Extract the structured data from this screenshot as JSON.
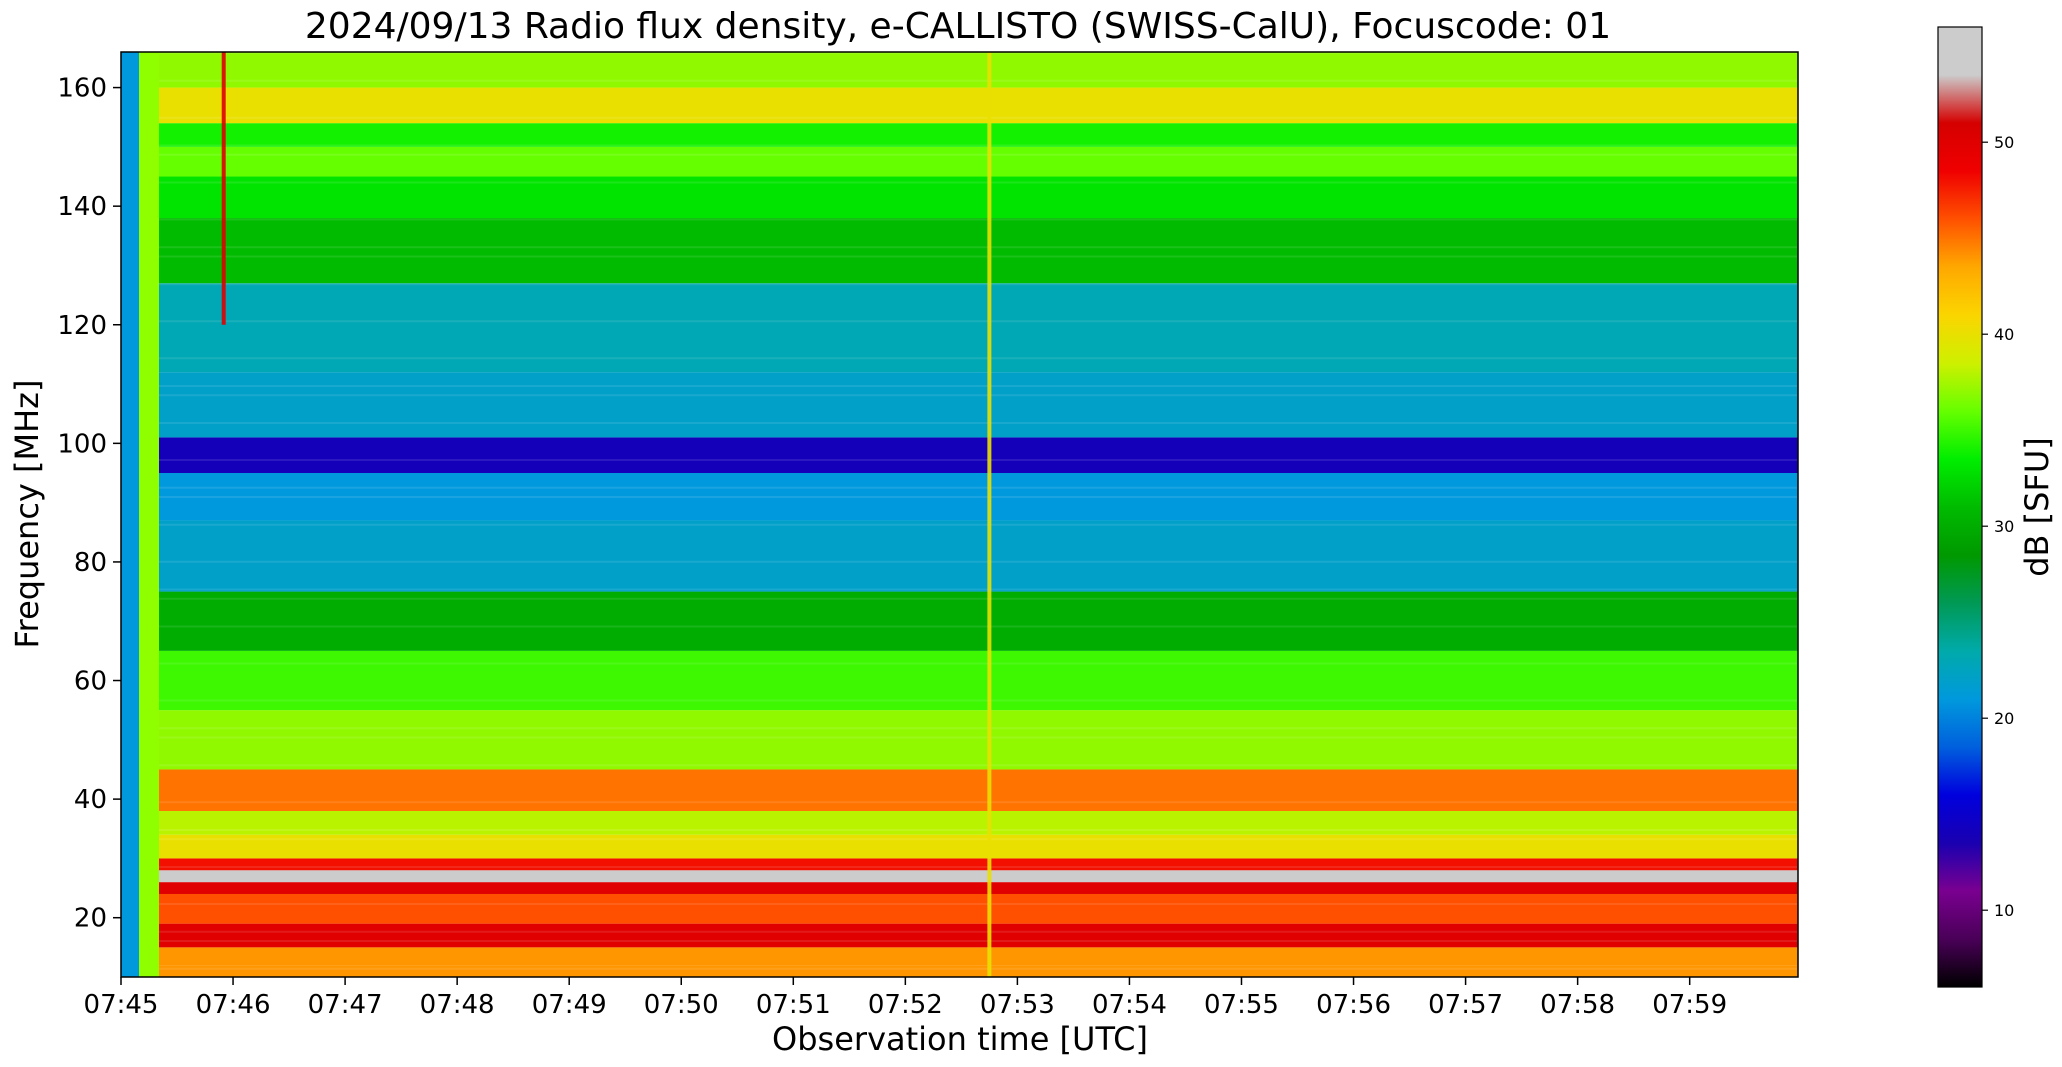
{
  "chart_data": {
    "type": "heatmap",
    "title": "2024/09/13  Radio flux density, e-CALLISTO (SWISS-CalU), Focuscode: 01",
    "xlabel": "Observation time [UTC]",
    "ylabel": "Frequency [MHz]",
    "x_range": [
      "07:45:00",
      "07:59:58"
    ],
    "y_range": [
      10,
      166
    ],
    "xticks": [
      "07:45",
      "07:46",
      "07:47",
      "07:48",
      "07:49",
      "07:50",
      "07:51",
      "07:52",
      "07:53",
      "07:54",
      "07:55",
      "07:56",
      "07:57",
      "07:58",
      "07:59"
    ],
    "yticks": [
      20,
      40,
      60,
      80,
      100,
      120,
      140,
      160
    ],
    "colorbar": {
      "label": "dB [SFU]",
      "range": [
        6,
        56
      ],
      "ticks": [
        10,
        20,
        30,
        40,
        50
      ],
      "colormap": "nipy_spectral"
    },
    "frequency_bands_dB": [
      {
        "freq": [
          12,
          15
        ],
        "dB": 44
      },
      {
        "freq": [
          15,
          19
        ],
        "dB": 50
      },
      {
        "freq": [
          19,
          24
        ],
        "dB": 46
      },
      {
        "freq": [
          24,
          26
        ],
        "dB": 50
      },
      {
        "freq": [
          26,
          28
        ],
        "dB": 55
      },
      {
        "freq": [
          28,
          30
        ],
        "dB": 48
      },
      {
        "freq": [
          30,
          34
        ],
        "dB": 40
      },
      {
        "freq": [
          34,
          38
        ],
        "dB": 38
      },
      {
        "freq": [
          38,
          45
        ],
        "dB": 45
      },
      {
        "freq": [
          45,
          55
        ],
        "dB": 37
      },
      {
        "freq": [
          55,
          65
        ],
        "dB": 35
      },
      {
        "freq": [
          65,
          75
        ],
        "dB": 30
      },
      {
        "freq": [
          75,
          87
        ],
        "dB": 22
      },
      {
        "freq": [
          87,
          95
        ],
        "dB": 21
      },
      {
        "freq": [
          95,
          101
        ],
        "dB": 14
      },
      {
        "freq": [
          101,
          112
        ],
        "dB": 22
      },
      {
        "freq": [
          112,
          127
        ],
        "dB": 23
      },
      {
        "freq": [
          127,
          138
        ],
        "dB": 31
      },
      {
        "freq": [
          138,
          145
        ],
        "dB": 33
      },
      {
        "freq": [
          145,
          150
        ],
        "dB": 36
      },
      {
        "freq": [
          150,
          154
        ],
        "dB": 34
      },
      {
        "freq": [
          154,
          160
        ],
        "dB": 40
      },
      {
        "freq": [
          160,
          166
        ],
        "dB": 37
      }
    ],
    "features": [
      {
        "type": "vertical_burst",
        "time": "07:45:55",
        "freq": [
          120,
          166
        ],
        "dB": 50
      },
      {
        "type": "vertical_burst",
        "time": "07:52:45",
        "freq": [
          10,
          166
        ],
        "dB": 40
      }
    ]
  }
}
